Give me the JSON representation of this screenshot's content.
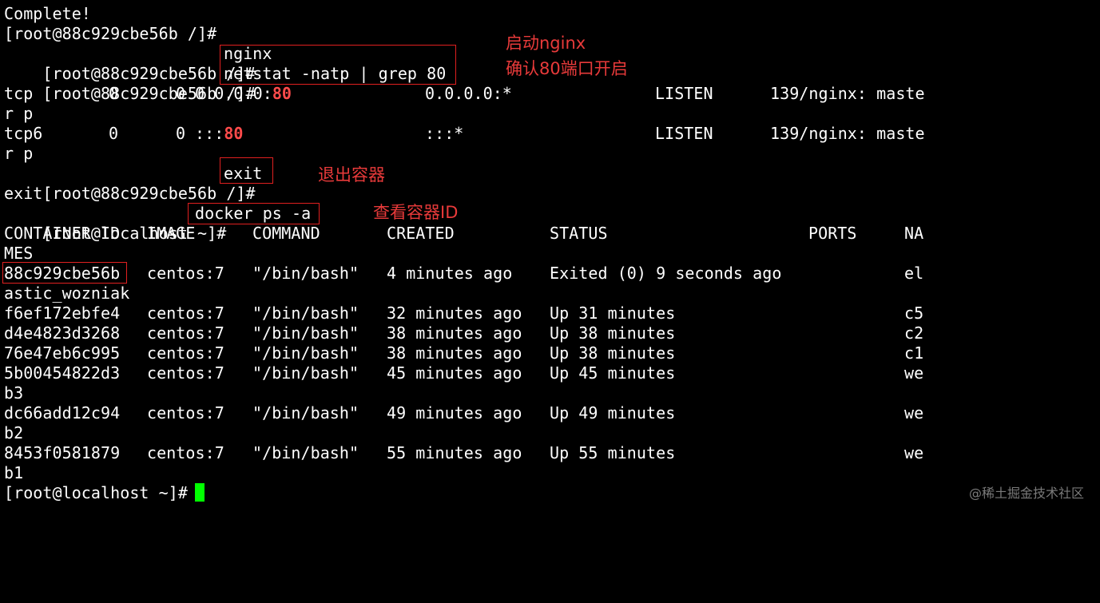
{
  "terminal": {
    "line1": "Complete!",
    "line2": "[root@88c929cbe56b /]#",
    "line3_prompt": "[root@88c929cbe56b /]#",
    "line3_cmd": "nginx",
    "line4_prompt": "[root@88c929cbe56b /]#",
    "line4_cmd": "netstat -natp | grep 80",
    "netstat": [
      {
        "proto": "tcp",
        "recvq": "0",
        "sendq": "0",
        "local_pre": "0.0.0.0:",
        "local_port": "80",
        "foreign": "0.0.0.0:*",
        "state": "LISTEN",
        "pid": "139/nginx: maste",
        "wrap": "r p"
      },
      {
        "proto": "tcp6",
        "recvq": "0",
        "sendq": "0",
        "local_pre": ":::",
        "local_port": "80",
        "foreign": ":::*",
        "state": "LISTEN",
        "pid": "139/nginx: maste",
        "wrap": "r p"
      }
    ],
    "exit_prompt": "[root@88c929cbe56b /]#",
    "exit_cmd": "exit",
    "exit_output": "exit",
    "host_prompt": "[root@localhost ~]#",
    "docker_cmd": "docker ps -a",
    "headers": {
      "id": "CONTAINER ID",
      "image": "IMAGE",
      "command": "COMMAND",
      "created": "CREATED",
      "status": "STATUS",
      "ports": "PORTS",
      "names": "NA",
      "names_wrap": "MES"
    },
    "containers": [
      {
        "id": "88c929cbe56b",
        "image": "centos:7",
        "command": "\"/bin/bash\"",
        "created": "4 minutes ago",
        "status": "Exited (0) 9 seconds ago",
        "names": "el",
        "wrap": "astic_wozniak"
      },
      {
        "id": "f6ef172ebfe4",
        "image": "centos:7",
        "command": "\"/bin/bash\"",
        "created": "32 minutes ago",
        "status": "Up 31 minutes",
        "names": "c5",
        "wrap": ""
      },
      {
        "id": "d4e4823d3268",
        "image": "centos:7",
        "command": "\"/bin/bash\"",
        "created": "38 minutes ago",
        "status": "Up 38 minutes",
        "names": "c2",
        "wrap": ""
      },
      {
        "id": "76e47eb6c995",
        "image": "centos:7",
        "command": "\"/bin/bash\"",
        "created": "38 minutes ago",
        "status": "Up 38 minutes",
        "names": "c1",
        "wrap": ""
      },
      {
        "id": "5b00454822d3",
        "image": "centos:7",
        "command": "\"/bin/bash\"",
        "created": "45 minutes ago",
        "status": "Up 45 minutes",
        "names": "we",
        "wrap": "b3"
      },
      {
        "id": "dc66add12c94",
        "image": "centos:7",
        "command": "\"/bin/bash\"",
        "created": "49 minutes ago",
        "status": "Up 49 minutes",
        "names": "we",
        "wrap": "b2"
      },
      {
        "id": "8453f0581879",
        "image": "centos:7",
        "command": "\"/bin/bash\"",
        "created": "55 minutes ago",
        "status": "Up 55 minutes",
        "names": "we",
        "wrap": "b1"
      }
    ],
    "final_prompt": "[root@localhost ~]#"
  },
  "annotations": {
    "start_nginx": "启动nginx",
    "confirm_port": "确认80端口开启",
    "exit_container": "退出容器",
    "view_container_id": "查看容器ID"
  },
  "watermark": "@稀土掘金技术社区",
  "colors": {
    "background": "#000000",
    "text": "#ffffff",
    "highlight": "#ff4b4b",
    "annotation": "#e83a3a",
    "cursor": "#00ff00"
  }
}
